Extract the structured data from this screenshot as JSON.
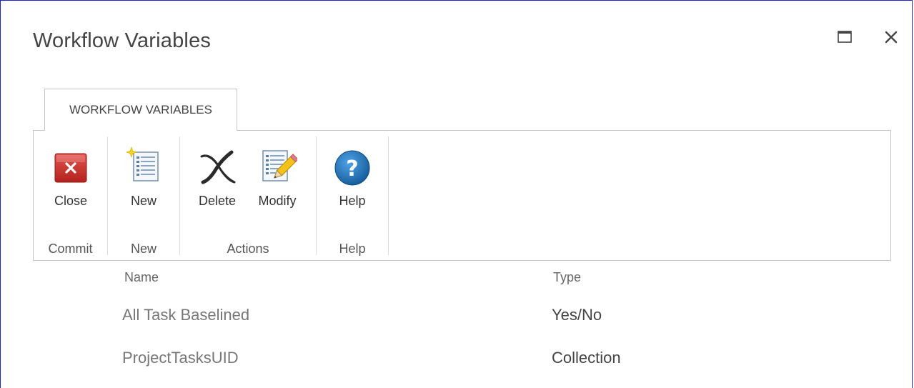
{
  "dialog": {
    "title": "Workflow Variables"
  },
  "ribbon": {
    "tab_label": "WORKFLOW VARIABLES",
    "groups": [
      {
        "label": "Commit",
        "buttons": [
          {
            "label": "Close",
            "icon": "close-icon"
          }
        ]
      },
      {
        "label": "New",
        "buttons": [
          {
            "label": "New",
            "icon": "new-document-icon"
          }
        ]
      },
      {
        "label": "Actions",
        "buttons": [
          {
            "label": "Delete",
            "icon": "delete-x-icon"
          },
          {
            "label": "Modify",
            "icon": "modify-pencil-icon"
          }
        ]
      },
      {
        "label": "Help",
        "buttons": [
          {
            "label": "Help",
            "icon": "help-question-icon"
          }
        ]
      }
    ]
  },
  "table": {
    "columns": [
      "Name",
      "Type"
    ],
    "rows": [
      {
        "name": "All Task Baselined",
        "type": "Yes/No"
      },
      {
        "name": "ProjectTasksUID",
        "type": "Collection"
      }
    ]
  },
  "colors": {
    "border_accent": "#1d24c9",
    "close_red": "#c9302c",
    "help_blue": "#1e6fb7"
  }
}
